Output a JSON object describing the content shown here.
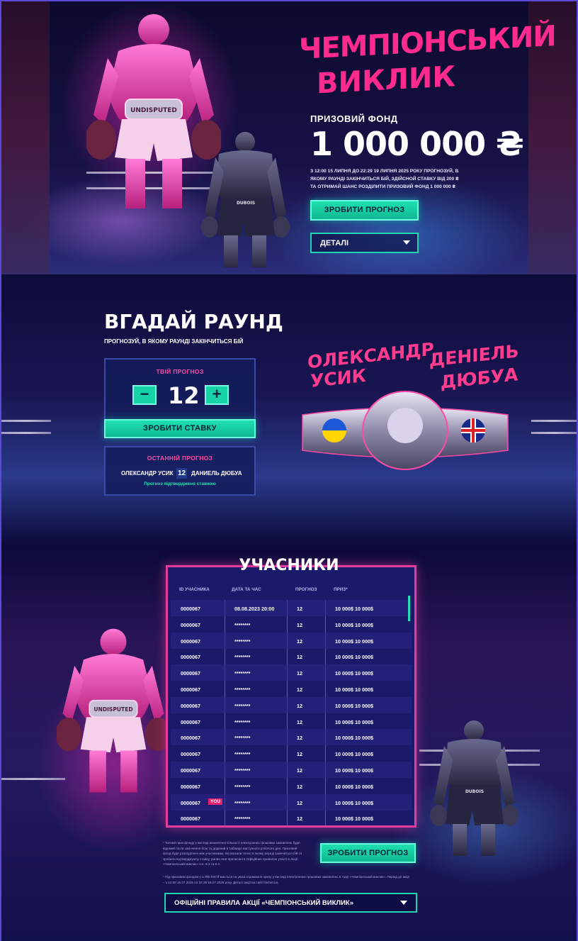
{
  "hero": {
    "title_line1": "ЧЕМПІОНСЬКИЙ",
    "title_line2": "ВИКЛИК",
    "prize_label": "ПРИЗОВИЙ ФОНД",
    "prize_amount": "1 000 000 ₴",
    "prize_star": "*",
    "description": "З 12:00 15 ЛИПНЯ ДО 22:29 19 ЛИПНЯ 2025 РОКУ ПРОГНОЗУЙ, В ЯКОМУ РАУНДІ ЗАКІНЧИТЬСЯ БІЙ, ЗДІЙСНОЙ СТАВКУ ВІД 200 ₴ ТА ОТРИМАЙ ШАНС РОЗДІЛИТИ ПРИЗОВИЙ ФОНД 1 000 000 ₴",
    "cta_label": "ЗРОБИТИ ПРОГНОЗ",
    "details_label": "ДЕТАЛІ",
    "belt_text": "UNDISPUTED",
    "shorts_text": "DUBOIS"
  },
  "round": {
    "title": "ВГАДАЙ РАУНД",
    "subtitle": "ПРОГНОЗУЙ, В ЯКОМУ РАУНДІ ЗАКІНЧИТЬСЯ БІЙ",
    "forecast_header": "ТВІЙ ПРОГНОЗ",
    "minus": "−",
    "plus": "+",
    "round_value": "12",
    "bet_label": "ЗРОБИТИ СТАВКУ",
    "last_header": "ОСТАННІЙ ПРОГНОЗ",
    "last_fighter_1": "ОЛЕКСАНДР УСИК",
    "last_round": "12",
    "last_fighter_2": "ДАНИЕЛЬ ДЮБУА",
    "confirmed": "Прогноз підтверджено ставкою",
    "fighter1_line1": "ОЛЕКСАНДР",
    "fighter1_line2": "УСИК",
    "fighter2_line1": "ДЕНІЕЛЬ",
    "fighter2_line2": "ДЮБУА"
  },
  "participants": {
    "title": "УЧАСНИКИ",
    "columns": [
      "ID УЧАСНИКА",
      "ДАТА ТА ЧАС",
      "ПРОГНОЗ",
      "ПРИЗ*"
    ],
    "rows": [
      {
        "id": "0000067",
        "date": "08.08.2023 20:00",
        "forecast": "12",
        "prize": "10 000$ 10 000$",
        "you": ""
      },
      {
        "id": "0000067",
        "date": "********",
        "forecast": "12",
        "prize": "10 000$ 10 000$",
        "you": ""
      },
      {
        "id": "0000067",
        "date": "********",
        "forecast": "12",
        "prize": "10 000$ 10 000$",
        "you": ""
      },
      {
        "id": "0000067",
        "date": "********",
        "forecast": "12",
        "prize": "10 000$ 10 000$",
        "you": ""
      },
      {
        "id": "0000067",
        "date": "********",
        "forecast": "12",
        "prize": "10 000$ 10 000$",
        "you": ""
      },
      {
        "id": "0000067",
        "date": "********",
        "forecast": "12",
        "prize": "10 000$ 10 000$",
        "you": ""
      },
      {
        "id": "0000067",
        "date": "********",
        "forecast": "12",
        "prize": "10 000$ 10 000$",
        "you": ""
      },
      {
        "id": "0000067",
        "date": "********",
        "forecast": "12",
        "prize": "10 000$ 10 000$",
        "you": ""
      },
      {
        "id": "0000067",
        "date": "********",
        "forecast": "12",
        "prize": "10 000$ 10 000$",
        "you": ""
      },
      {
        "id": "0000067",
        "date": "********",
        "forecast": "12",
        "prize": "10 000$ 10 000$",
        "you": ""
      },
      {
        "id": "0000067",
        "date": "********",
        "forecast": "12",
        "prize": "10 000$ 10 000$",
        "you": ""
      },
      {
        "id": "0000067",
        "date": "********",
        "forecast": "12",
        "prize": "10 000$ 10 000$",
        "you": ""
      },
      {
        "id": "0000067",
        "date": "********",
        "forecast": "12",
        "prize": "10 000$ 10 000$",
        "you": "YOU"
      },
      {
        "id": "0000067",
        "date": "********",
        "forecast": "12",
        "prize": "10 000$ 10 000$",
        "you": ""
      }
    ],
    "note1": "* Точний приз фонду у вигляді визначеної кількості електронних грошових замовлень буде відомий після закінчення бою та доданий в таблицю наступного робочого дня. Призовий фонд буде розподілено між учасниками, які вказали точно в якому раунді закінчиться бій та зробили підтверджуючу ставку, умови якої прописані в Офіційних правилах участі в Акції «Чемпіонський виклик» п.п. 8.3 та 8.4.",
    "note2": "* Під призовим фондом у 1 000 000 ₴ мається на увазі отримання призу у вигляді електронних грошових замовлень в Акції «Чемпіонський виклик». Період дії акції – з 12:00 15.07.2025 по 22:29 19.07.2025 року. Деталі акції на сайті favbet.ua.",
    "cta_label": "ЗРОБИТИ ПРОГНОЗ",
    "rules_label": "ОФІЦІЙНІ ПРАВИЛА АКЦІЇ «ЧЕМПІОНСЬКИЙ ВИКЛИК»",
    "belt_text": "UNDISPUTED",
    "shorts_text": "DUBOIS"
  },
  "colors": {
    "accent_pink": "#ff2a8e",
    "accent_green": "#1fe0b0",
    "background": "#0b0a3a",
    "table_border": "#e23d9c"
  }
}
